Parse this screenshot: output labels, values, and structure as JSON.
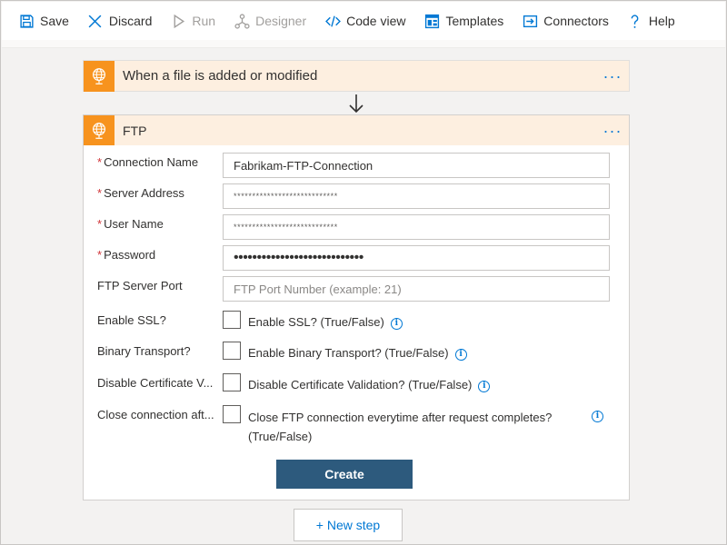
{
  "toolbar": {
    "save": "Save",
    "discard": "Discard",
    "run": "Run",
    "designer": "Designer",
    "code_view": "Code view",
    "templates": "Templates",
    "connectors": "Connectors",
    "help": "Help"
  },
  "trigger": {
    "title": "When a file is added or modified",
    "icon": "ftp-globe-icon",
    "more": "···"
  },
  "ftp": {
    "title": "FTP",
    "more": "···",
    "fields": {
      "connection_name": {
        "label": "Connection Name",
        "value": "Fabrikam-FTP-Connection",
        "required": true
      },
      "server_address": {
        "label": "Server Address",
        "value": "****************************",
        "required": true
      },
      "user_name": {
        "label": "User Name",
        "value": "****************************",
        "required": true
      },
      "password": {
        "label": "Password",
        "value": "••••••••••••••••••••••••••••",
        "required": true
      },
      "port": {
        "label": "FTP Server Port",
        "value": "",
        "placeholder": "FTP Port Number (example: 21)"
      }
    },
    "checkboxes": {
      "ssl": {
        "label": "Enable SSL?",
        "text": "Enable SSL? (True/False)"
      },
      "binary": {
        "label": "Binary Transport?",
        "text": "Enable Binary Transport? (True/False)"
      },
      "cert": {
        "label": "Disable Certificate V...",
        "text": "Disable Certificate Validation? (True/False)"
      },
      "close": {
        "label": "Close connection aft...",
        "text": "Close FTP connection everytime after request completes? (True/False)"
      }
    },
    "create": "Create"
  },
  "new_step": "+ New step",
  "colors": {
    "accent": "#0078d4",
    "connector_orange": "#f7931e",
    "header_bg": "#fdefe0",
    "create_button": "#2d5a7d",
    "required": "#d13438"
  }
}
